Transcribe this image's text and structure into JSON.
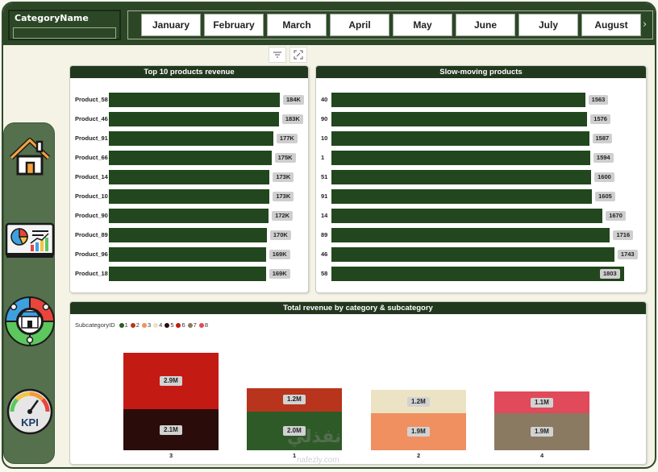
{
  "header": {
    "category_slicer_title": "CategoryName",
    "months": [
      "January",
      "February",
      "March",
      "April",
      "May",
      "June",
      "July",
      "August"
    ]
  },
  "sidebar": {
    "items": [
      {
        "icon": "home-icon"
      },
      {
        "icon": "dashboard-chart-icon"
      },
      {
        "icon": "store-customers-icon"
      },
      {
        "icon": "kpi-gauge-icon"
      }
    ]
  },
  "top_products": {
    "title": "Top 10 products revenue",
    "bar_color": "#22471e",
    "rows": [
      {
        "label": "Product_58",
        "value": 184,
        "display": "184K"
      },
      {
        "label": "Product_46",
        "value": 183,
        "display": "183K"
      },
      {
        "label": "Product_91",
        "value": 177,
        "display": "177K"
      },
      {
        "label": "Product_66",
        "value": 175,
        "display": "175K"
      },
      {
        "label": "Product_14",
        "value": 173,
        "display": "173K"
      },
      {
        "label": "Product_10",
        "value": 173,
        "display": "173K"
      },
      {
        "label": "Product_90",
        "value": 172,
        "display": "172K"
      },
      {
        "label": "Product_89",
        "value": 170,
        "display": "170K"
      },
      {
        "label": "Product_96",
        "value": 169,
        "display": "169K"
      },
      {
        "label": "Product_18",
        "value": 169,
        "display": "169K"
      }
    ]
  },
  "slow_moving": {
    "title": "Slow-moving products",
    "bar_color": "#22471e",
    "rows": [
      {
        "label": "40",
        "value": 1563,
        "display": "1563"
      },
      {
        "label": "90",
        "value": 1576,
        "display": "1576"
      },
      {
        "label": "10",
        "value": 1587,
        "display": "1587"
      },
      {
        "label": "1",
        "value": 1594,
        "display": "1594"
      },
      {
        "label": "51",
        "value": 1600,
        "display": "1600"
      },
      {
        "label": "91",
        "value": 1605,
        "display": "1605"
      },
      {
        "label": "14",
        "value": 1670,
        "display": "1670"
      },
      {
        "label": "89",
        "value": 1716,
        "display": "1716"
      },
      {
        "label": "46",
        "value": 1743,
        "display": "1743"
      },
      {
        "label": "58",
        "value": 1803,
        "display": "1803"
      }
    ]
  },
  "category_revenue": {
    "title": "Total revenue by category & subcategory",
    "legend_title": "SubcategoryID",
    "legend": [
      {
        "label": "1",
        "color": "#2e5a27"
      },
      {
        "label": "2",
        "color": "#b8341c"
      },
      {
        "label": "3",
        "color": "#f09060"
      },
      {
        "label": "4",
        "color": "#ebe3c4"
      },
      {
        "label": "5",
        "color": "#2a0d0a"
      },
      {
        "label": "6",
        "color": "#c41a14"
      },
      {
        "label": "7",
        "color": "#8a7a62"
      },
      {
        "label": "8",
        "color": "#e04a5a"
      }
    ],
    "chart_data": {
      "type": "bar",
      "stacked": true,
      "categories": [
        "3",
        "1",
        "2",
        "4"
      ],
      "series_segments": [
        {
          "category": "3",
          "segments": [
            {
              "subcategory": "5",
              "value": 2.1,
              "display": "2.1M",
              "color": "#2a0d0a"
            },
            {
              "subcategory": "6",
              "value": 2.9,
              "display": "2.9M",
              "color": "#c41a14"
            }
          ]
        },
        {
          "category": "1",
          "segments": [
            {
              "subcategory": "1",
              "value": 2.0,
              "display": "2.0M",
              "color": "#2e5a27"
            },
            {
              "subcategory": "2",
              "value": 1.2,
              "display": "1.2M",
              "color": "#b8341c"
            }
          ]
        },
        {
          "category": "2",
          "segments": [
            {
              "subcategory": "3",
              "value": 1.9,
              "display": "1.9M",
              "color": "#f09060"
            },
            {
              "subcategory": "4",
              "value": 1.2,
              "display": "1.2M",
              "color": "#ebe3c4"
            }
          ]
        },
        {
          "category": "4",
          "segments": [
            {
              "subcategory": "7",
              "value": 1.9,
              "display": "1.9M",
              "color": "#8a7a62"
            },
            {
              "subcategory": "8",
              "value": 1.1,
              "display": "1.1M",
              "color": "#e04a5a"
            }
          ]
        }
      ]
    }
  },
  "watermark": {
    "text": "نفذلي",
    "sub": "nafezly.com"
  }
}
